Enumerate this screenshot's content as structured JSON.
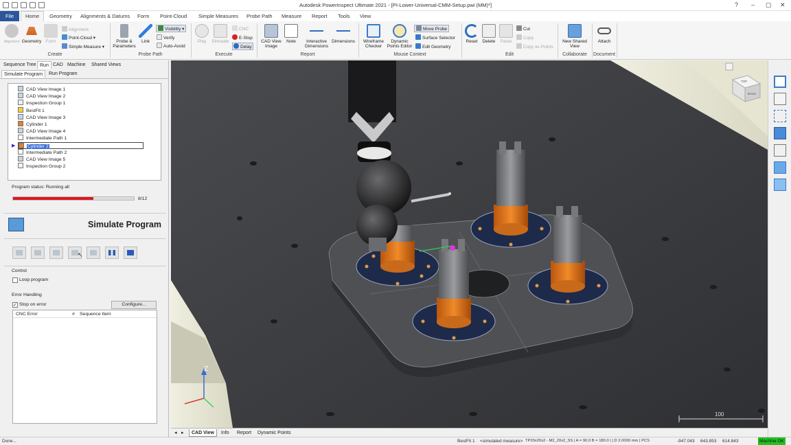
{
  "app": {
    "title": "Autodesk PowerInspect Ultimate 2021 - [PI-Lower-Universal-CMM-Setup.pwi (MM)*]"
  },
  "menu": {
    "file": "File",
    "items": [
      "Home",
      "Geometry",
      "Alignments & Datums",
      "Form",
      "Point-Cloud",
      "Simple Measures",
      "Probe Path",
      "Measure",
      "Report",
      "Tools",
      "View"
    ]
  },
  "ribbon": {
    "create": {
      "label": "Create",
      "alignment": "Alignment",
      "geometry": "Geometry",
      "form": "Form",
      "point_cloud": "Point-Cloud",
      "simple_measure": "Simple Measure"
    },
    "probe_path": {
      "label": "Probe Path",
      "probe_params": "Probe & Parameters",
      "link": "Link",
      "visibility": "Visibility",
      "verify": "Verify",
      "auto_avoid": "Auto-Avoid"
    },
    "execute": {
      "label": "Execute",
      "play": "Play",
      "simulate": "Simulate",
      "cnc": "CNC",
      "estop": "E-Stop",
      "delay": "Delay"
    },
    "report": {
      "label": "Report",
      "cad_view_image": "CAD View Image",
      "note": "Note",
      "interactive_dimensions": "Interactive Dimensions",
      "dimensions": "Dimensions"
    },
    "mouse_context": {
      "label": "Mouse Context",
      "wireframe_checker": "Wireframe Checker",
      "dynamic_points_editor": "Dynamic Points Editor",
      "move_probe": "Move Probe",
      "surface_selector": "Surface Selector",
      "edit_geometry": "Edit Geometry"
    },
    "edit": {
      "label": "Edit",
      "reset": "Reset",
      "delete": "Delete",
      "paste": "Paste",
      "cut": "Cut",
      "copy": "Copy",
      "copy_as_points": "Copy as Points"
    },
    "collaborate": {
      "label": "Collaborate",
      "new_shared_view": "New Shared View"
    },
    "document": {
      "label": "Document",
      "attach": "Attach"
    }
  },
  "panel": {
    "tabs": [
      "Sequence Tree",
      "Run",
      "CAD",
      "Machine",
      "Shared Views"
    ],
    "subtabs": [
      "Simulate Program",
      "Run Program"
    ],
    "tree": [
      "CAD View Image 1",
      "CAD View Image 2",
      "Inspection Group 1",
      "BestFit 1",
      "CAD View Image 3",
      "Cylinder 1",
      "CAD View Image 4",
      "Intermediate Path 1",
      "Cylinder 2",
      "Intermediate Path 2",
      "CAD View Image 5",
      "Inspection Group 2"
    ],
    "selected_item": "Cylinder 2",
    "program_status": "Program status: Running all",
    "progress": {
      "current": 8,
      "total": 12,
      "label": "8/12",
      "fraction": 0.667
    },
    "simulate_title": "Simulate Program",
    "control_label": "Control",
    "loop_program": "Loop program",
    "error_handling_label": "Error Handling",
    "stop_on_error": "Stop on error",
    "configure": "Configure...",
    "error_columns": [
      "CNC Error",
      "#",
      "Sequence Item"
    ]
  },
  "viewport": {
    "scale_label": "100",
    "axis_z": "Z",
    "cube_top": "TOP",
    "cube_back": "BACK",
    "cube_right": "RIGHT"
  },
  "view_tabs": [
    "CAD View",
    "Info",
    "Report",
    "Dynamic Points"
  ],
  "status": {
    "left": "Done...",
    "item": "BestFit 1",
    "measure": "<simulated measure>",
    "probe": "TP20x20x2 - M2_20x2_SS | A = 90.0 B = 180.0 | | D 2.0000 mm | PCS",
    "x": "-947.043",
    "y": "643.853",
    "z": "614.843",
    "machine": "Machine OK"
  },
  "colors": {
    "accent": "#2b579a",
    "progress": "#e0161e",
    "machine_ok": "#22c022",
    "selection": "#3b6fd8"
  }
}
